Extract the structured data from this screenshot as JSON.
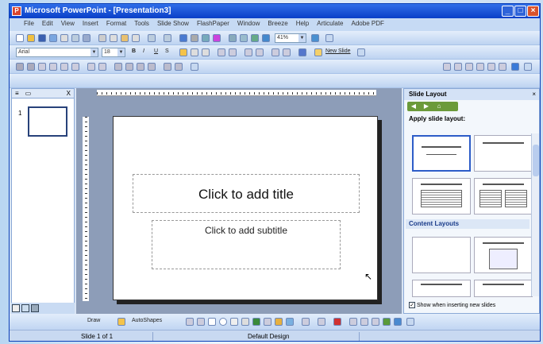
{
  "window": {
    "title": "Microsoft PowerPoint - [Presentation3]",
    "app_icon": "P",
    "min": "_",
    "max": "□",
    "close": "×"
  },
  "menu": {
    "items": [
      "File",
      "Edit",
      "View",
      "Insert",
      "Format",
      "Tools",
      "Slide Show",
      "FlashPaper",
      "Window",
      "Breeze",
      "Help",
      "Articulate",
      "Adobe PDF"
    ]
  },
  "toolbar_standard": {
    "zoom": "41%"
  },
  "toolbar_formatting": {
    "font": "Arial",
    "size": "18",
    "bold": "B",
    "italic": "I",
    "underline": "U",
    "shadow": "S",
    "new_slide": "New Slide"
  },
  "left_pane": {
    "tab_outline": "≡",
    "tab_slides": "▭",
    "close": "X",
    "slide_number": "1"
  },
  "slide": {
    "title_placeholder": "Click to add title",
    "subtitle_placeholder": "Click to add subtitle"
  },
  "task_pane": {
    "title": "Slide Layout",
    "close": "×",
    "apply_label": "Apply slide layout:",
    "section_content": "Content Layouts",
    "show_checkbox": "Show when inserting new slides",
    "checked": "✓"
  },
  "drawing": {
    "draw": "Draw",
    "autoshapes": "AutoShapes"
  },
  "status": {
    "slide": "Slide 1 of 1",
    "design": "Default Design"
  },
  "colors": {
    "title_bar": "#0a3fc8",
    "accent": "#2d5cc8"
  }
}
